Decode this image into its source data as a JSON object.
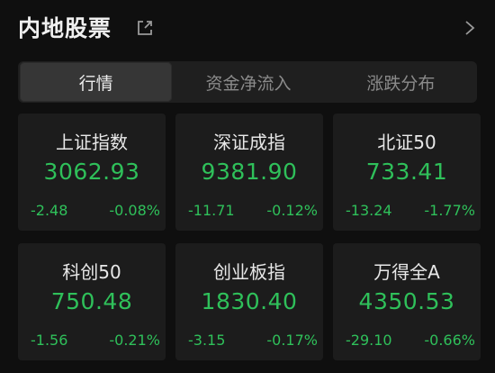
{
  "header": {
    "title": "内地股票"
  },
  "tabs": [
    {
      "label": "行情",
      "active": true
    },
    {
      "label": "资金净流入",
      "active": false
    },
    {
      "label": "涨跌分布",
      "active": false
    }
  ],
  "indices": [
    {
      "name": "上证指数",
      "price": "3062.93",
      "change": "-2.48",
      "percent": "-0.08%"
    },
    {
      "name": "深证成指",
      "price": "9381.90",
      "change": "-11.71",
      "percent": "-0.12%"
    },
    {
      "name": "北证50",
      "price": "733.41",
      "change": "-13.24",
      "percent": "-1.77%"
    },
    {
      "name": "科创50",
      "price": "750.48",
      "change": "-1.56",
      "percent": "-0.21%"
    },
    {
      "name": "创业板指",
      "price": "1830.40",
      "change": "-3.15",
      "percent": "-0.17%"
    },
    {
      "name": "万得全A",
      "price": "4350.53",
      "change": "-29.10",
      "percent": "-0.66%"
    }
  ],
  "colors": {
    "down": "#2fc05a",
    "background": "#0f0f0f",
    "card": "#1c1c1c"
  }
}
